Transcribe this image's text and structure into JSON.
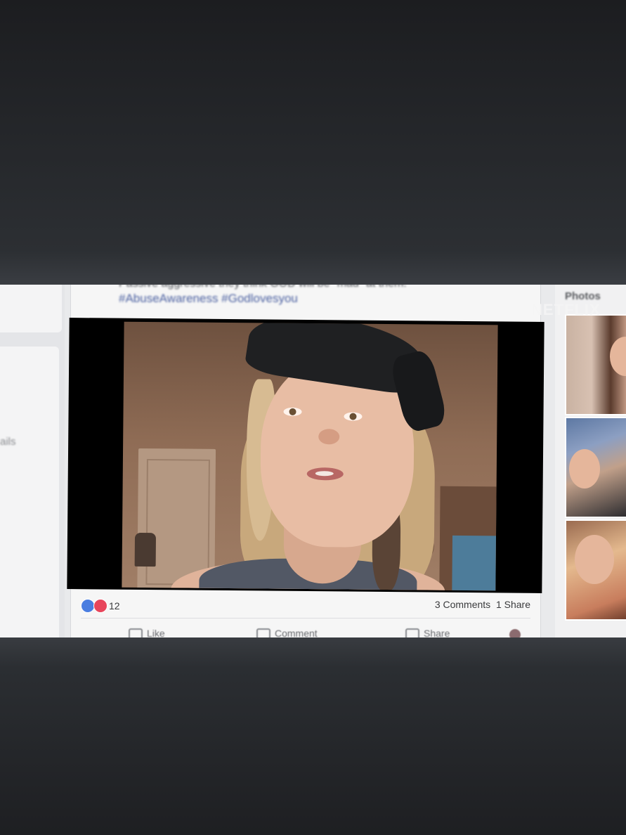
{
  "post": {
    "text_line": "Passive aggressive they think GOD will be \"mad\" at them.",
    "hashtags": "#AbuseAwareness #Godlovesyou",
    "reaction_count": "12",
    "comments": "3 Comments",
    "shares": "1 Share",
    "actions": {
      "like": "Like",
      "comment": "Comment",
      "share": "Share"
    }
  },
  "left_sidebar": {
    "fragment_text": "ails"
  },
  "right_sidebar": {
    "photos_label": "Photos"
  },
  "watermark": "NETFLIX",
  "colors": {
    "like_blue": "#4a7de0",
    "love_red": "#e8455b",
    "hashtag_blue": "#4a5fa0"
  }
}
